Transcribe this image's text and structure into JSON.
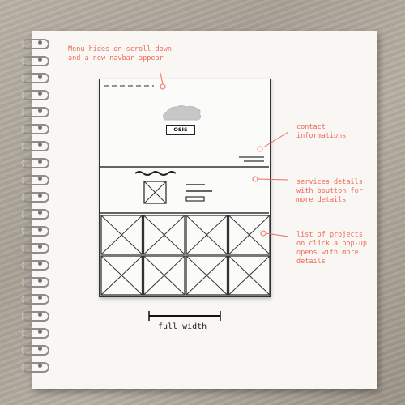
{
  "sketch": {
    "logo_label": "OSIS"
  },
  "annotations": {
    "menu": [
      "Menu hides on scroll down",
      "and a new navbar appear"
    ],
    "contact": [
      "contact",
      "informations"
    ],
    "services": [
      "services details",
      "with boutton for",
      "more details"
    ],
    "projects": [
      "list of projects",
      "on click a pop-up",
      "opens with more",
      "details"
    ]
  },
  "caption": "full width"
}
